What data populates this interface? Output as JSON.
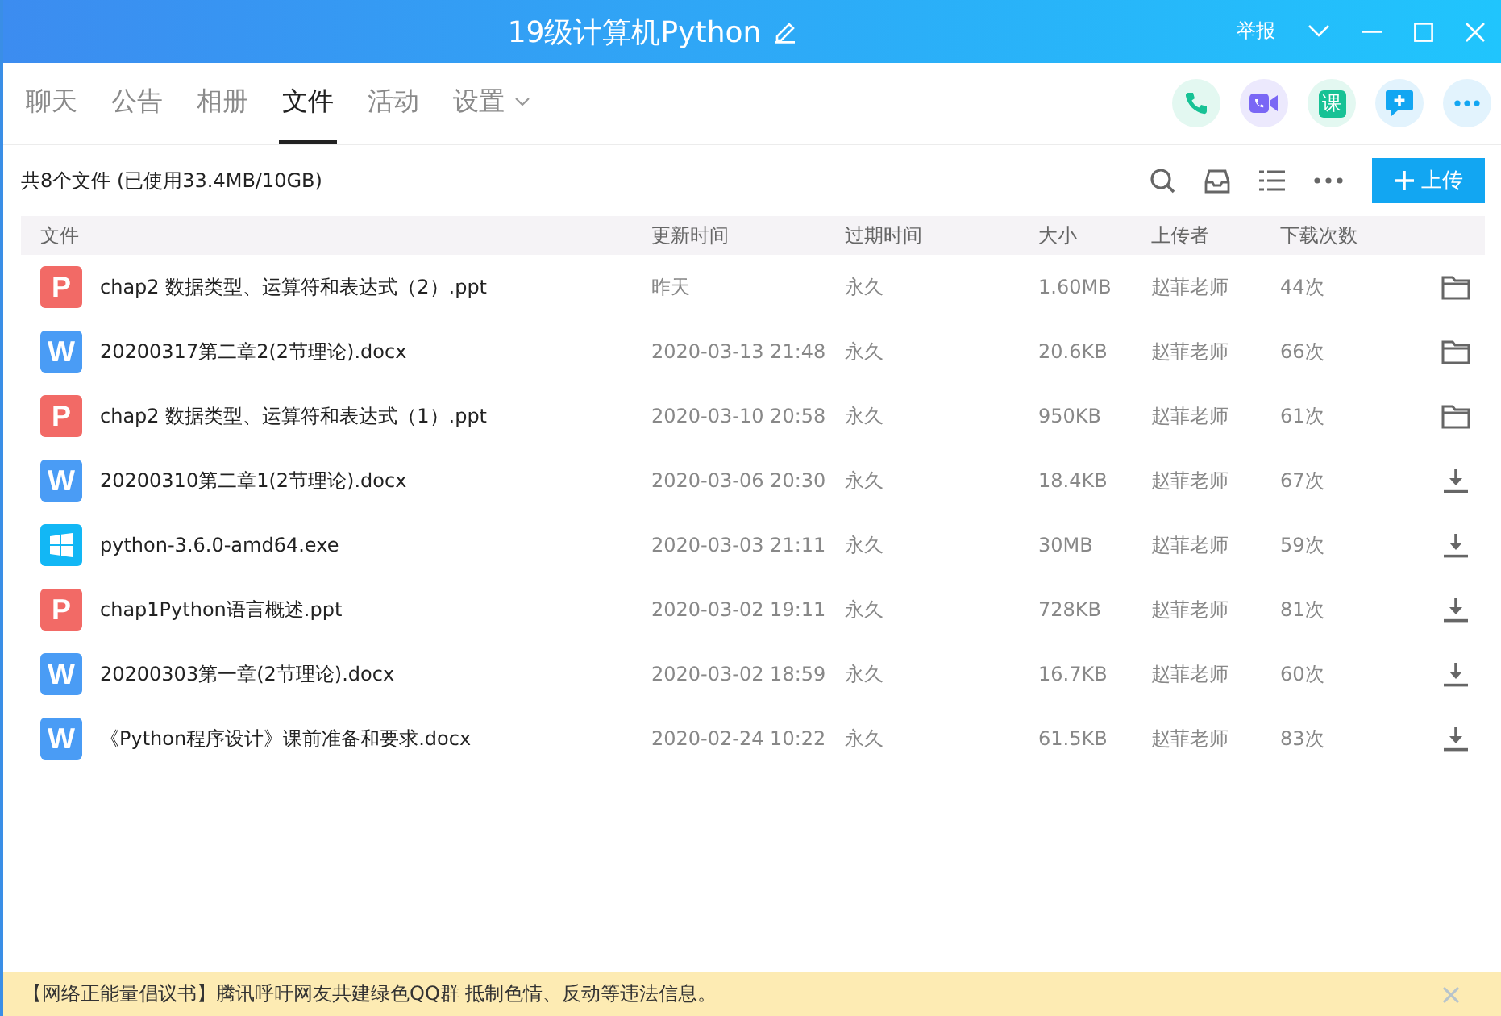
{
  "window": {
    "title": "19级计算机Python",
    "report": "举报"
  },
  "tabs": [
    {
      "label": "聊天",
      "selected": false
    },
    {
      "label": "公告",
      "selected": false
    },
    {
      "label": "相册",
      "selected": false
    },
    {
      "label": "文件",
      "selected": true
    },
    {
      "label": "活动",
      "selected": false
    },
    {
      "label": "设置",
      "selected": false,
      "dropdown": true
    }
  ],
  "quick_actions": [
    {
      "kind": "phone"
    },
    {
      "kind": "video"
    },
    {
      "kind": "text",
      "label": "课"
    },
    {
      "kind": "chat"
    },
    {
      "kind": "more"
    }
  ],
  "summary": "共8个文件 (已使用33.4MB/10GB)",
  "upload_button": "上传",
  "table": {
    "columns": [
      "文件",
      "更新时间",
      "过期时间",
      "大小",
      "上传者",
      "下载次数"
    ],
    "rows": [
      {
        "kind": "ppt",
        "badge": "P",
        "name": "chap2 数据类型、运算符和表达式（2）.ppt",
        "updated": "昨天",
        "expires": "永久",
        "size": "1.60MB",
        "uploader": "赵菲老师",
        "downloads": "44次",
        "downloaded": true
      },
      {
        "kind": "doc",
        "badge": "W",
        "name": "20200317第二章2(2节理论).docx",
        "updated": "2020-03-13 21:48",
        "expires": "永久",
        "size": "20.6KB",
        "uploader": "赵菲老师",
        "downloads": "66次",
        "downloaded": true
      },
      {
        "kind": "ppt",
        "badge": "P",
        "name": "chap2 数据类型、运算符和表达式（1）.ppt",
        "updated": "2020-03-10 20:58",
        "expires": "永久",
        "size": "950KB",
        "uploader": "赵菲老师",
        "downloads": "61次",
        "downloaded": true
      },
      {
        "kind": "doc",
        "badge": "W",
        "name": "20200310第二章1(2节理论).docx",
        "updated": "2020-03-06 20:30",
        "expires": "永久",
        "size": "18.4KB",
        "uploader": "赵菲老师",
        "downloads": "67次",
        "downloaded": false
      },
      {
        "kind": "exe",
        "name": "python-3.6.0-amd64.exe",
        "updated": "2020-03-03 21:11",
        "expires": "永久",
        "size": "30MB",
        "uploader": "赵菲老师",
        "downloads": "59次",
        "downloaded": false
      },
      {
        "kind": "ppt",
        "badge": "P",
        "name": "chap1Python语言概述.ppt",
        "updated": "2020-03-02 19:11",
        "expires": "永久",
        "size": "728KB",
        "uploader": "赵菲老师",
        "downloads": "81次",
        "downloaded": false
      },
      {
        "kind": "doc",
        "badge": "W",
        "name": "20200303第一章(2节理论).docx",
        "updated": "2020-03-02 18:59",
        "expires": "永久",
        "size": "16.7KB",
        "uploader": "赵菲老师",
        "downloads": "60次",
        "downloaded": false
      },
      {
        "kind": "doc",
        "badge": "W",
        "name": "《Python程序设计》课前准备和要求.docx",
        "updated": "2020-02-24 10:22",
        "expires": "永久",
        "size": "61.5KB",
        "uploader": "赵菲老师",
        "downloads": "83次",
        "downloaded": false
      }
    ]
  },
  "notice": "【网络正能量倡议书】腾讯呼吁网友共建绿色QQ群 抵制色情、反动等违法信息。"
}
